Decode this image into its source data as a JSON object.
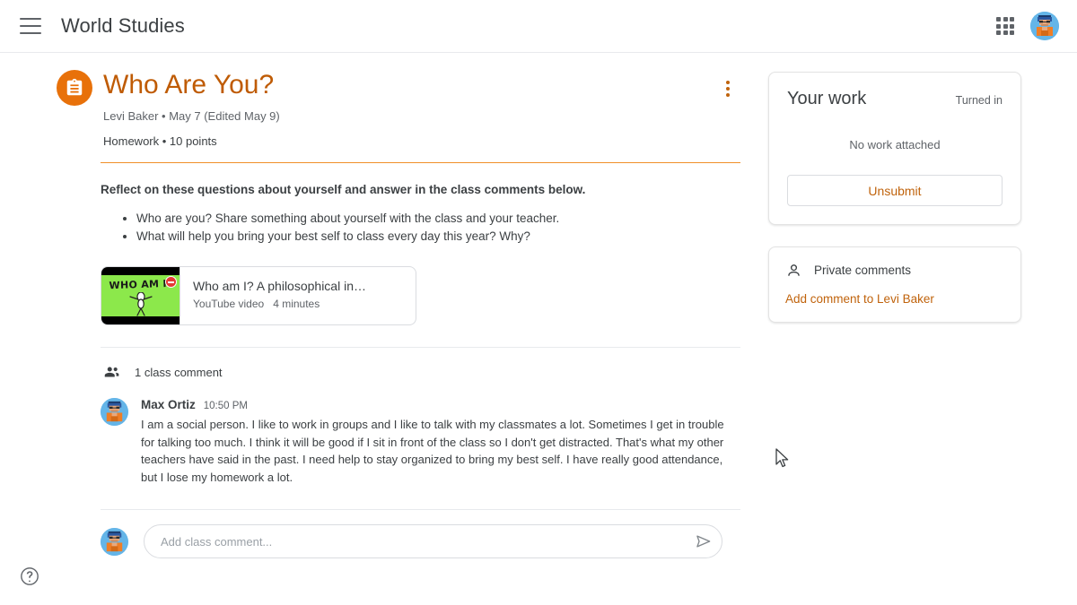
{
  "header": {
    "menu_icon": "hamburger-menu-icon",
    "class_name": "World Studies",
    "apps_icon": "apps-grid-icon",
    "avatar": "user-avatar"
  },
  "assignment": {
    "icon": "assignment-clipboard-icon",
    "title": "Who Are You?",
    "meta": "Levi Baker • May 7 (Edited May 9)",
    "subinfo": "Homework • 10 points",
    "overflow_icon": "more-vertical-icon",
    "instructions": "Reflect on these questions about yourself and answer in the class comments below.",
    "questions": [
      "Who are you? Share something about yourself with the class and your teacher.",
      "What will help you bring your best self to class every day this year? Why?"
    ],
    "attachment": {
      "thumbnail_text": "WHO AM I?",
      "thumbnail_badge": "youtube-badge-icon",
      "title": "Who am I? A philosophical in…",
      "type": "YouTube video",
      "duration": "4 minutes"
    }
  },
  "class_comments": {
    "icon": "people-icon",
    "count_label": "1 class comment",
    "comments": [
      {
        "avatar": "commenter-avatar",
        "author": "Max Ortiz",
        "time": "10:50 PM",
        "text": "I am a social person. I like to work in groups and I like to talk with my classmates a lot. Sometimes I get in trouble for talking too much. I think it will be good if I sit in front of the class so I don't get distracted. That's what my other teachers have said in the past. I need help to stay organized to bring my best self.  I have really good attendance, but I lose my homework a lot."
      }
    ],
    "compose": {
      "avatar": "current-user-avatar",
      "placeholder": "Add class comment...",
      "value": "",
      "send_icon": "send-icon"
    }
  },
  "your_work": {
    "title": "Your work",
    "status": "Turned in",
    "empty_label": "No work attached",
    "unsubmit_label": "Unsubmit"
  },
  "private_comments": {
    "icon": "person-icon",
    "title": "Private comments",
    "add_link": "Add comment to Levi Baker"
  },
  "footer": {
    "help_icon": "help-circle-icon"
  },
  "colors": {
    "accent_orange": "#e8710a",
    "title_orange": "#bf5b04",
    "link_orange": "#c0630c",
    "rule_orange": "#f18f29",
    "text_primary": "#3c4043",
    "text_secondary": "#5f6368",
    "border": "#dadce0"
  }
}
